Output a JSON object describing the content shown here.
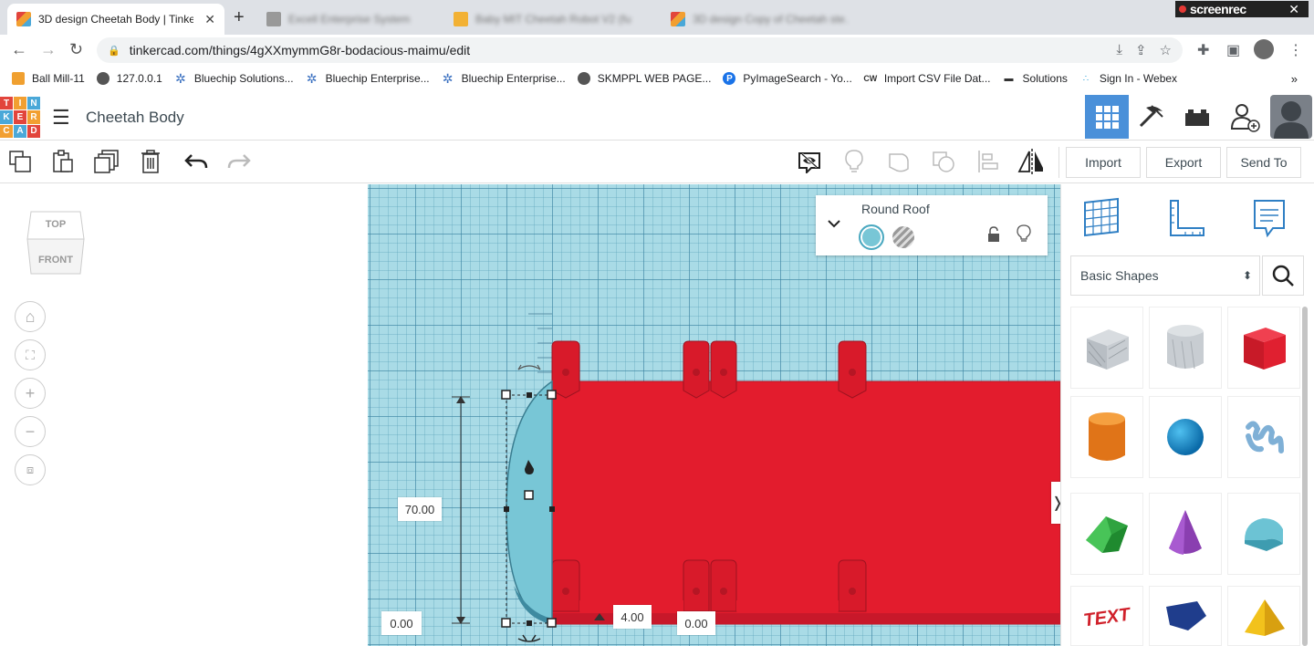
{
  "browser": {
    "tabs": [
      {
        "title": "3D design Cheetah Body | Tinkercad",
        "active": true
      },
      {
        "title": "Excell Enterprise System",
        "active": false
      },
      {
        "title": "Baby MIT Cheetah Robot V2 (fu…",
        "active": false
      },
      {
        "title": "3D design Copy of Cheetah ste…",
        "active": false
      }
    ],
    "new_tab": "+",
    "screenrec_label": "screenrec",
    "url": "tinkercad.com/things/4gXXmymmG8r-bodacious-maimu/edit",
    "bookmarks": [
      {
        "label": "Ball Mill-11",
        "icon": "doc-icon"
      },
      {
        "label": "127.0.0.1",
        "icon": "globe-icon"
      },
      {
        "label": "Bluechip Solutions...",
        "icon": "star-icon"
      },
      {
        "label": "Bluechip Enterprise...",
        "icon": "star-icon"
      },
      {
        "label": "Bluechip Enterprise...",
        "icon": "star-icon"
      },
      {
        "label": "SKMPPL WEB PAGE...",
        "icon": "globe-icon"
      },
      {
        "label": "PyImageSearch - Yo...",
        "icon": "p-icon"
      },
      {
        "label": "Import CSV File Dat...",
        "icon": "cw-icon"
      },
      {
        "label": "Solutions",
        "icon": "dash-icon"
      },
      {
        "label": "Sign In - Webex",
        "icon": "webex-icon"
      }
    ],
    "bookmarks_more": "»"
  },
  "app": {
    "logo_letters": [
      "T",
      "I",
      "N",
      "K",
      "E",
      "R",
      "C",
      "A",
      "D"
    ],
    "logo_colors": [
      "#e2453c",
      "#f29f31",
      "#4aa8d8",
      "#e2453c",
      "#f29f31",
      "#4aa8d8",
      "#e2453c",
      "#f29f31",
      "#4aa8d8"
    ],
    "design_name": "Cheetah Body",
    "toolbar": {
      "import_label": "Import",
      "export_label": "Export",
      "send_to_label": "Send To"
    },
    "viewcube": {
      "top": "TOP",
      "front": "FRONT"
    },
    "inspector": {
      "shape_name": "Round Roof",
      "solid_color": "#78c6d6"
    },
    "dimensions": {
      "height": "70.00",
      "elevation": "0.00",
      "width": "4.00",
      "offset": "0.00"
    },
    "shapes_panel": {
      "category": "Basic Shapes",
      "shapes": [
        {
          "name": "box-hole",
          "color": "#b8bec4"
        },
        {
          "name": "cylinder-hole",
          "color": "#c8cdd2"
        },
        {
          "name": "box",
          "color": "#e02030"
        },
        {
          "name": "cylinder",
          "color": "#f0841c"
        },
        {
          "name": "sphere",
          "color": "#1a8fd0"
        },
        {
          "name": "scribble",
          "color": "#7fb0d6"
        },
        {
          "name": "roof",
          "color": "#2fa33f"
        },
        {
          "name": "cone",
          "color": "#8a3fb0"
        },
        {
          "name": "round-roof",
          "color": "#6cc3d4"
        },
        {
          "name": "text",
          "color": "#d0202a"
        },
        {
          "name": "polygon",
          "color": "#1f3d8c"
        },
        {
          "name": "pyramid",
          "color": "#f2c21c"
        }
      ]
    },
    "colors": {
      "workplane": "#a9dbe6",
      "body_red": "#e31c2d",
      "accent_blue": "#4a90d9"
    }
  }
}
